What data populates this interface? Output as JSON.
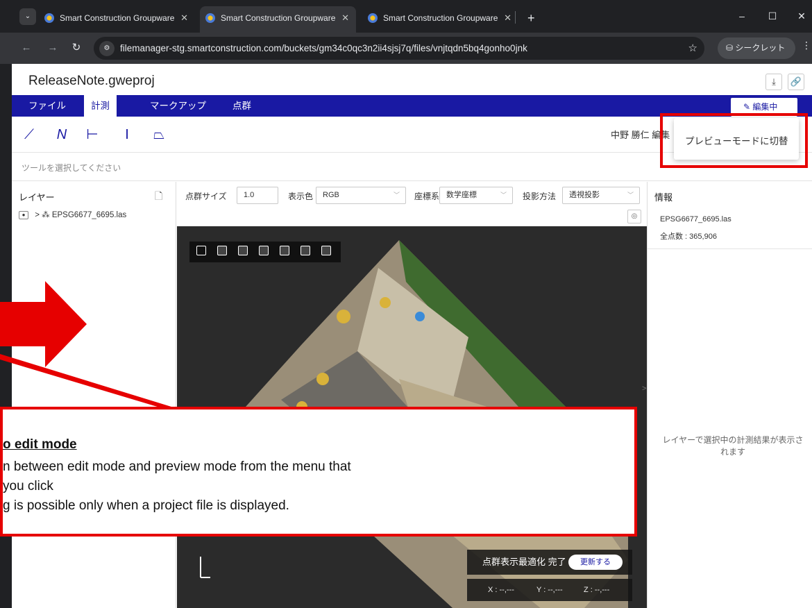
{
  "browser": {
    "tabs": [
      {
        "title": "Smart Construction Groupware",
        "close": "✕"
      },
      {
        "title": "Smart Construction Groupware",
        "close": "✕"
      },
      {
        "title": "Smart Construction Groupware",
        "close": "✕"
      }
    ],
    "new_tab": "+",
    "url": "filemanager-stg.smartconstruction.com/buckets/gm34c0qc3n2ii4sjsj7q/files/vnjtqdn5bq4gonho0jnk",
    "incognito_label": "シークレット"
  },
  "app": {
    "title": "ReleaseNote.gweproj",
    "menu": [
      "ファイル",
      "計測",
      "マークアップ",
      "点群"
    ],
    "active_menu": "計測",
    "edit_button": "編集中",
    "user_info": "中野 勝仁 編集",
    "hint": "ツールを選択してください"
  },
  "layers": {
    "header": "レイヤー",
    "items": [
      {
        "name": "EPSG6677_6695.las"
      }
    ]
  },
  "viewer_controls": {
    "point_size_label": "点群サイズ",
    "point_size_value": "1.0",
    "color_label": "表示色",
    "color_value": "RGB",
    "coord_label": "座標系",
    "coord_value": "数学座標",
    "projection_label": "投影方法",
    "projection_value": "透視投影"
  },
  "canvas": {
    "optimization_text": "点群表示最適化 完了",
    "update_button": "更新する",
    "coord_x": "X : --,---",
    "coord_y": "Y : --,---",
    "coord_z": "Z : --,---"
  },
  "info": {
    "header": "情報",
    "file": "EPSG6677_6695.las",
    "count": "全点数 : 365,906",
    "empty_message": "レイヤーで選択中の計測結果が表示されます"
  },
  "tooltip": {
    "text": "プレビューモードに切替"
  },
  "callout": {
    "title": "o edit mode",
    "lines": [
      "n between edit mode and preview mode from the menu that",
      " you click",
      "g is possible only when a project file is displayed."
    ]
  },
  "colors": {
    "brand": "#1919a3",
    "annotation_red": "#e60000"
  }
}
